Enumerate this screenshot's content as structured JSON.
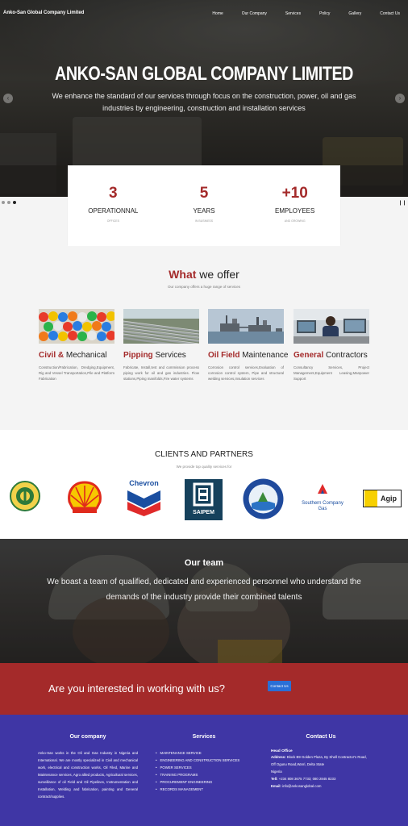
{
  "brand": "Anko-San Global Company Limited",
  "nav": [
    "Home",
    "Our Company",
    "Services",
    "Policy",
    "Gallery",
    "Contact Us"
  ],
  "hero": {
    "title": "ANKO-SAN GLOBAL COMPANY LIMITED",
    "subtitle": "We enhance the standard of our services through focus on the construction, power, oil and gas industries by engineering, construction and installation services",
    "prev_icon": "chevron-left-icon",
    "next_icon": "chevron-right-icon",
    "slides_total": 3,
    "active_slide": 3,
    "pause_icon": "pause-icon"
  },
  "stats": [
    {
      "number": "3",
      "label": "OPERATIONNAL",
      "sub": "OFFICES"
    },
    {
      "number": "5",
      "label": "YEARS",
      "sub": "IN BUSINESS"
    },
    {
      "number": "+10",
      "label": "EMPLOYEES",
      "sub": "AND GROWING"
    }
  ],
  "offer": {
    "title_accent": "What",
    "title_rest": " we offer",
    "subtitle": "Our company offers a huge range of services",
    "cards": [
      {
        "accent": "Civil &",
        "rest": " Mechanical",
        "desc": "Construction/Fabrication, Dredging,Equipment, Rig and Vessel Transportation,Pile and Platform Fabrication",
        "image": "hard-hats-image"
      },
      {
        "accent": "Pipping",
        "rest": " Services",
        "desc": "Fabricate, Install,test and commission process piping work for oil and gas industries. Flow stations,Piping manifolds,Fire water systems",
        "image": "pipes-image"
      },
      {
        "accent": "Oil Field",
        "rest": " Maintenance",
        "desc": "Corrosion control services,Evaluation of corrosion control system, Pipe and structural welding services,Insulation services",
        "image": "offshore-platform-image"
      },
      {
        "accent": "General",
        "rest": " Contractors",
        "desc": "Consultancy Services, Project Management,Equipment Leasing,Manpower Support",
        "image": "control-room-image"
      }
    ]
  },
  "clients": {
    "title": "CLIENTS AND PARTNERS",
    "subtitle": "We provide top quality services for",
    "logos": [
      {
        "name": "nnpc-logo"
      },
      {
        "name": "shell-logo"
      },
      {
        "name": "chevron-logo",
        "text": "Chevron"
      },
      {
        "name": "saipem-logo",
        "text": "SAIPEM"
      },
      {
        "name": "ndda-logo"
      },
      {
        "name": "southern-company-gas-logo",
        "text": "Southern Company Gas"
      },
      {
        "name": "agip-logo",
        "text": "Agip"
      }
    ]
  },
  "team": {
    "title": "Our team",
    "desc": "We boast a team of qualified, dedicated and experienced personnel who understand the demands of the industry provide their combined talents"
  },
  "cta": {
    "text": "Are you interested in working with us?",
    "button": "Contact Us"
  },
  "footer": {
    "company_title": "Our company",
    "company_text": "Anko-San works in the Oil and Gas Industry in Nigeria and International. We are mostly specialized in Civil and mechanical work, electrical and construction works, Oil Filed, Marine and Maintenance services, Agro allied products, Agricultural services, surveillance of oil Field and Oil Pipelines, Instrumentation and Installation, Welding and fabrication, painting and General contract/supplies.",
    "services_title": "Services",
    "services": [
      "MAINTENANCE SERVICE",
      "ENGINEERING AND CONSTRUCTION SERVICES",
      "POWER SERVICES",
      "TRAINING PROGRAMS",
      "PROCUREMENT ENGINEERING",
      "RECORDS MANAGEMENT"
    ],
    "contact_title": "Contact Us",
    "office_label": "Head Office",
    "address_label": "Address:",
    "address": "Block B9 Golden Plaza, By Shell Contractor's Road, Off Ogunu Road,Warri, Delta State",
    "country": "Nigeria",
    "tel_label": "Tell:",
    "tel": "+234 808 3675 7733; 080 2845 8233",
    "email_label": "Email:",
    "email": "info@ankosanglobal.com"
  }
}
